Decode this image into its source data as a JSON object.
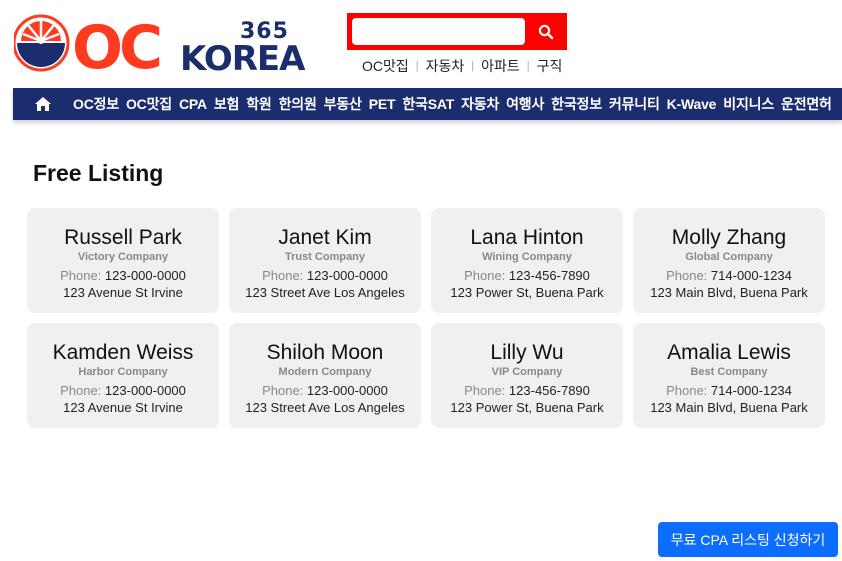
{
  "brand": {
    "logo_text": "OC",
    "logo_sub": "KOREA",
    "logo_number": "365",
    "colors": {
      "red": "#ff3b1f",
      "navy": "#1c2d6e",
      "search_red": "#ff0000"
    }
  },
  "search": {
    "placeholder": "",
    "value": "",
    "button_icon": "search-icon"
  },
  "quick_links": [
    "OC맛집",
    "자동차",
    "아파트",
    "구직"
  ],
  "nav": {
    "home_icon": "home-icon",
    "items": [
      "OC정보",
      "OC맛집",
      "CPA",
      "보험",
      "학원",
      "한의원",
      "부동산",
      "PET",
      "한국SAT",
      "자동차",
      "여행사",
      "한국정보",
      "커뮤니티",
      "K-Wave",
      "비지니스",
      "운전면허"
    ]
  },
  "section_title": "Free Listing",
  "listings": [
    {
      "name": "Russell Park",
      "company": "Victory Company",
      "phone_label": "Phone:",
      "phone": "123-000-0000",
      "address": "123 Avenue St Irvine"
    },
    {
      "name": "Janet Kim",
      "company": "Trust Company",
      "phone_label": "Phone:",
      "phone": "123-000-0000",
      "address": "123 Street Ave Los Angeles"
    },
    {
      "name": "Lana Hinton",
      "company": "Wining Company",
      "phone_label": "Phone:",
      "phone": "123-456-7890",
      "address": "123 Power St, Buena Park"
    },
    {
      "name": "Molly Zhang",
      "company": "Global Company",
      "phone_label": "Phone:",
      "phone": "714-000-1234",
      "address": "123 Main Blvd, Buena Park"
    },
    {
      "name": "Kamden Weiss",
      "company": "Harbor Company",
      "phone_label": "Phone:",
      "phone": "123-000-0000",
      "address": "123 Avenue St Irvine"
    },
    {
      "name": "Shiloh Moon",
      "company": "Modern Company",
      "phone_label": "Phone:",
      "phone": "123-000-0000",
      "address": "123 Street Ave Los Angeles"
    },
    {
      "name": "Lilly Wu",
      "company": "VIP Company",
      "phone_label": "Phone:",
      "phone": "123-456-7890",
      "address": "123 Power St, Buena Park"
    },
    {
      "name": "Amalia Lewis",
      "company": "Best Company",
      "phone_label": "Phone:",
      "phone": "714-000-1234",
      "address": "123 Main Blvd, Buena Park"
    }
  ],
  "cta_label": "무료 CPA 리스팅 신청하기"
}
